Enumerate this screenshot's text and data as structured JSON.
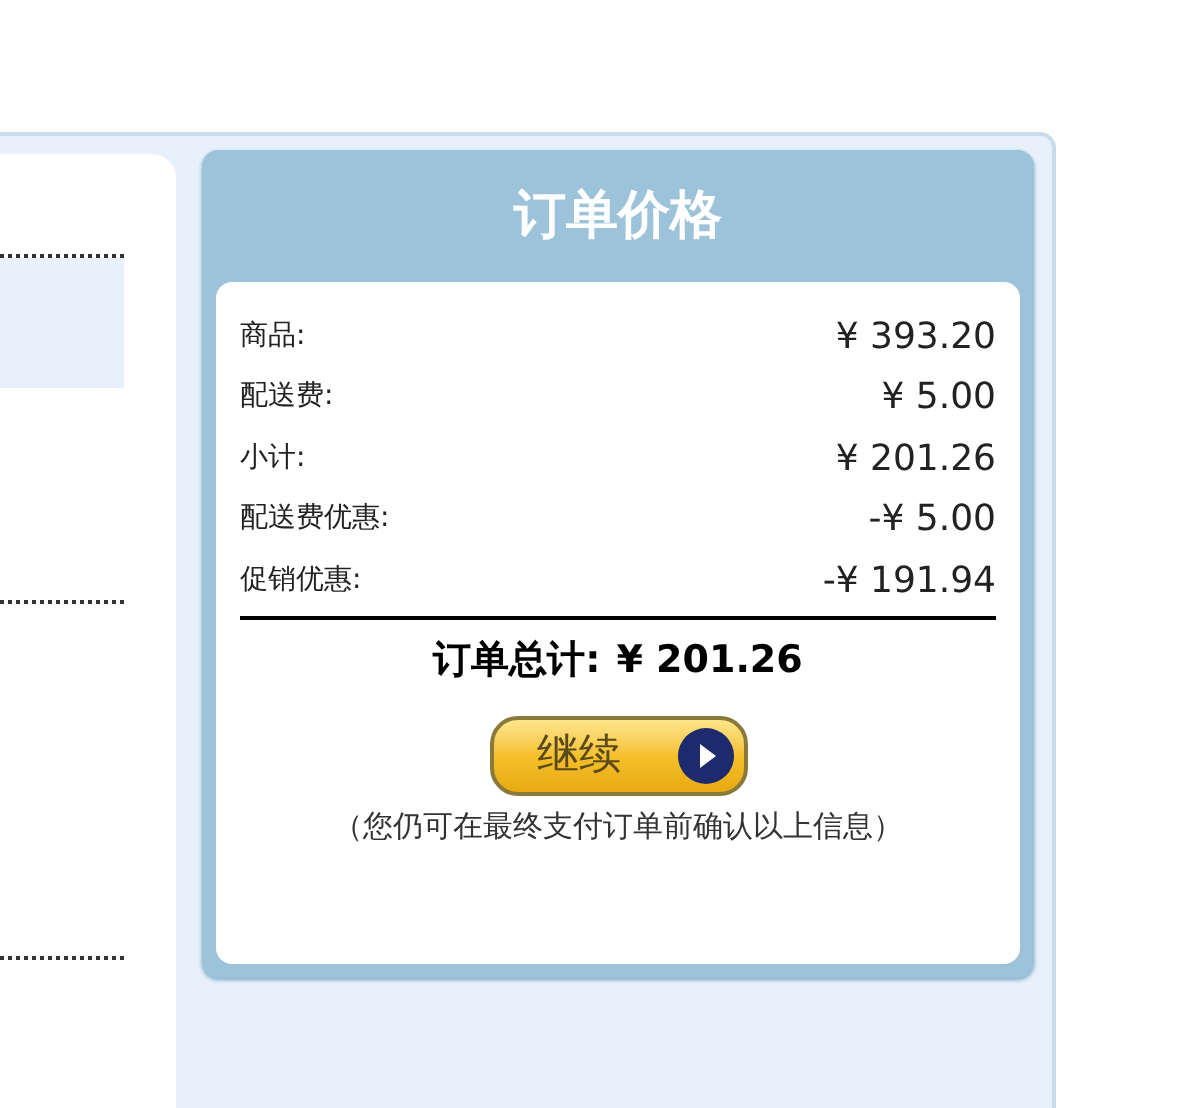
{
  "order_price": {
    "title": "订单价格",
    "rows": [
      {
        "label": "商品:",
        "value": "¥ 393.20"
      },
      {
        "label": "配送费:",
        "value": "¥ 5.00"
      },
      {
        "label": "小计:",
        "value": "¥ 201.26"
      },
      {
        "label": "配送费优惠:",
        "value": "-¥ 5.00"
      },
      {
        "label": "促销优惠:",
        "value": "-¥ 191.94"
      }
    ],
    "total": {
      "label": "订单总计:",
      "value": "¥ 201.26"
    },
    "button": "继续",
    "note": "（您仍可在最终支付订单前确认以上信息）"
  }
}
